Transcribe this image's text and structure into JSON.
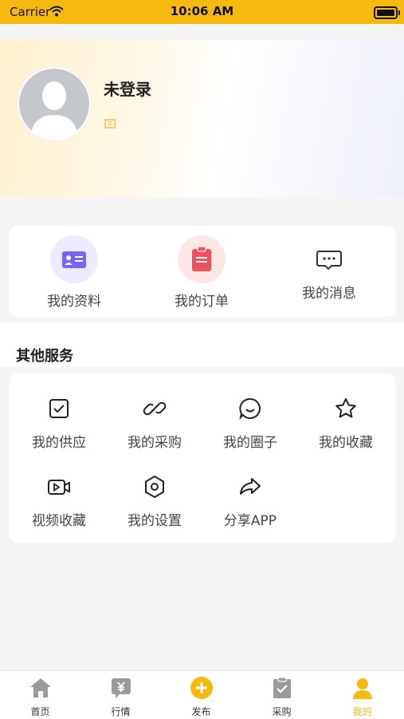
{
  "status_bar": {
    "carrier": "Carrier",
    "time": "10:06 AM"
  },
  "profile": {
    "name": "未登录"
  },
  "quick_actions": [
    {
      "label": "我的资料",
      "icon": "profile-card-icon",
      "color": "#7b61ff"
    },
    {
      "label": "我的订单",
      "icon": "clipboard-icon",
      "color": "#f0505a"
    },
    {
      "label": "我的消息",
      "icon": "chat-bubble-icon",
      "color": "#333333"
    }
  ],
  "other_services": {
    "title": "其他服务",
    "items": [
      {
        "label": "我的供应",
        "icon": "checkbox-icon"
      },
      {
        "label": "我的采购",
        "icon": "link-icon"
      },
      {
        "label": "我的圈子",
        "icon": "smile-chat-icon"
      },
      {
        "label": "我的收藏",
        "icon": "star-icon"
      },
      {
        "label": "视频收藏",
        "icon": "video-icon"
      },
      {
        "label": "我的设置",
        "icon": "settings-hex-icon"
      },
      {
        "label": "分享APP",
        "icon": "share-arrow-icon"
      }
    ]
  },
  "tab_bar": {
    "accent": "#f5b90f",
    "items": [
      {
        "label": "首页",
        "icon": "home-icon"
      },
      {
        "label": "行情",
        "icon": "market-yen-icon"
      },
      {
        "label": "发布",
        "icon": "publish-plus-icon"
      },
      {
        "label": "采购",
        "icon": "purchase-clipboard-icon"
      },
      {
        "label": "我的",
        "icon": "user-icon",
        "active": true
      }
    ]
  }
}
